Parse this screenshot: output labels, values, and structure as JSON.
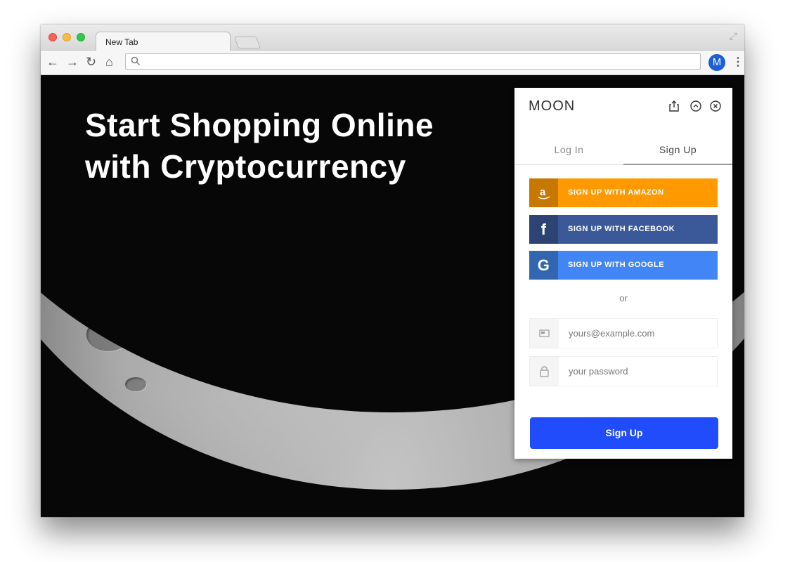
{
  "browser": {
    "tab_title": "New Tab",
    "address_value": "",
    "profile_initial": "M"
  },
  "hero": {
    "line1": "Start Shopping Online",
    "line2": "with Cryptocurrency"
  },
  "widget": {
    "brand": "MOON",
    "tabs": [
      "Log In",
      "Sign Up"
    ],
    "active_tab": "Sign Up",
    "social": {
      "amazon_label": "SIGN UP WITH AMAZON",
      "facebook_label": "SIGN UP WITH FACEBOOK",
      "google_label": "SIGN UP WITH GOOGLE"
    },
    "divider": "or",
    "email_placeholder": "yours@example.com",
    "password_placeholder": "your password",
    "submit_label": "Sign Up",
    "colors": {
      "amazon": "#ff9900",
      "facebook": "#3b5998",
      "google": "#4285f4",
      "submit": "#214cfc"
    }
  },
  "icons": [
    "search-icon",
    "back-icon",
    "forward-icon",
    "reload-icon",
    "home-icon",
    "share-icon",
    "collapse-icon",
    "close-icon",
    "amazon-icon",
    "facebook-icon",
    "google-icon",
    "email-icon",
    "lock-icon"
  ]
}
